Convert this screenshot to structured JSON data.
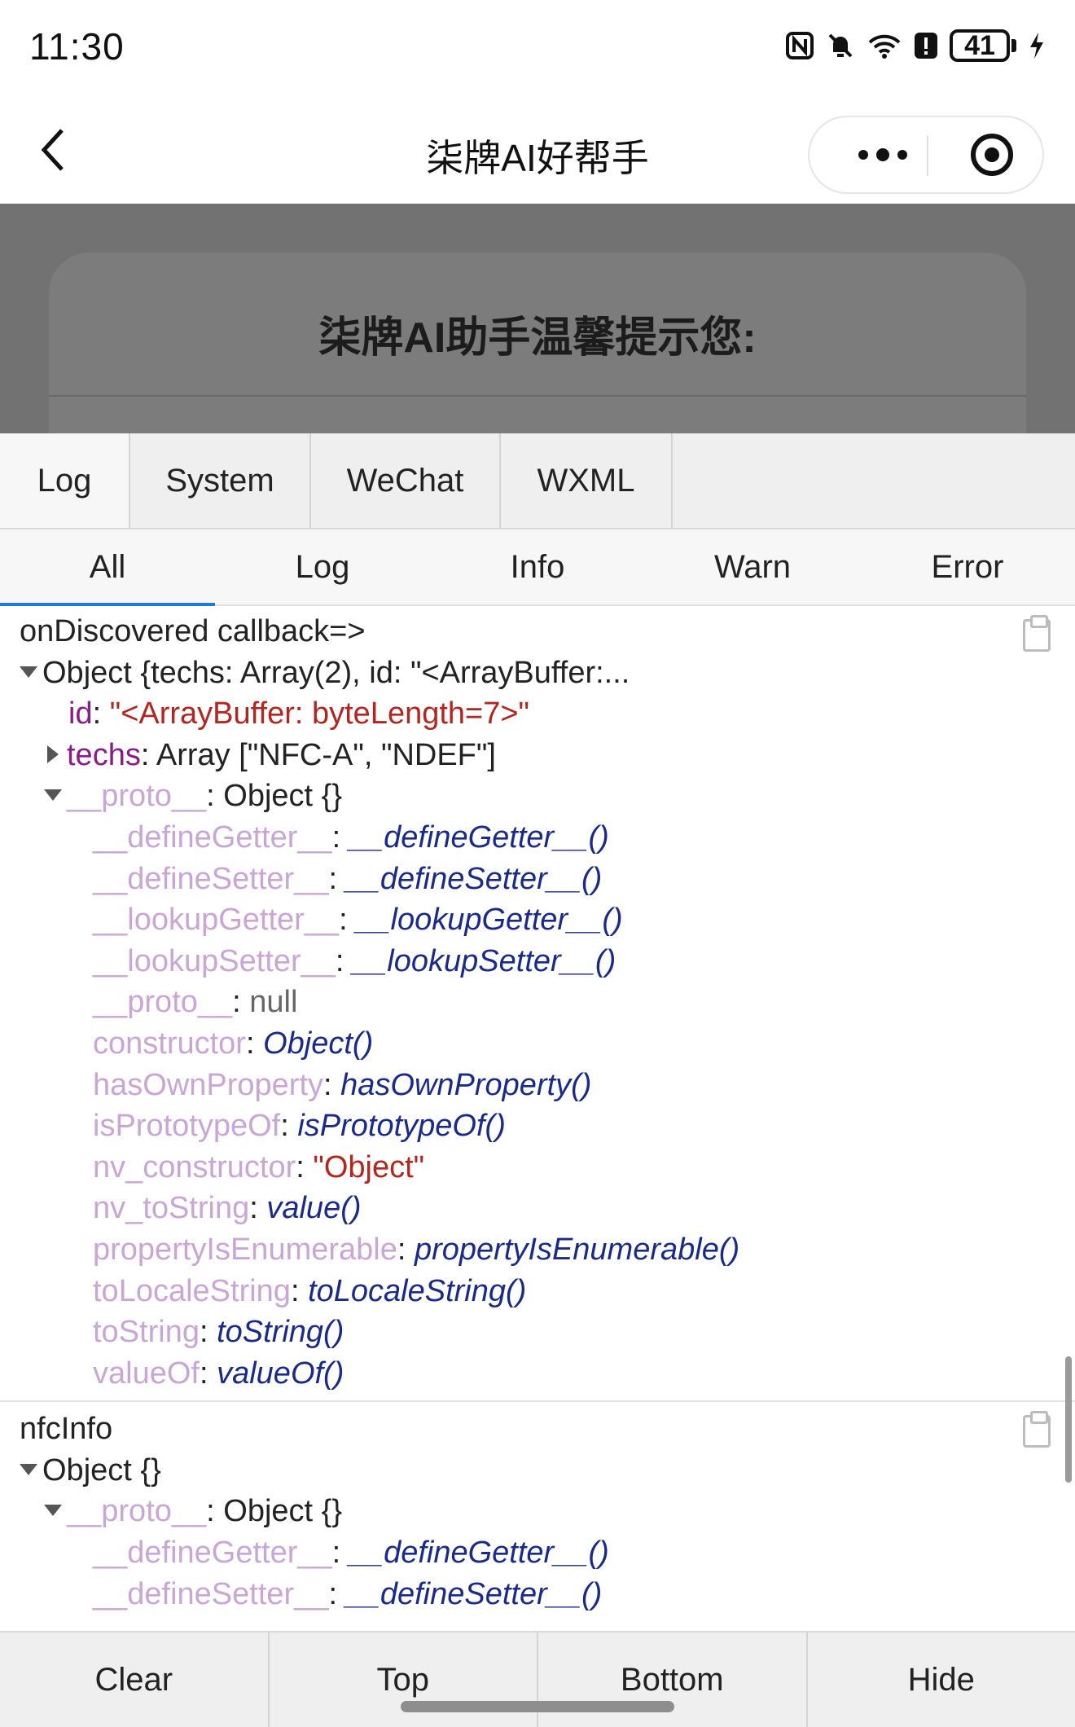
{
  "status_bar": {
    "time": "11:30",
    "battery": "41",
    "icons": [
      "nfc-icon",
      "bell-muted-icon",
      "wifi-icon",
      "alert-icon",
      "battery-icon",
      "charging-icon"
    ]
  },
  "title_bar": {
    "title": "柒牌AI好帮手",
    "icons": [
      "back-icon",
      "more-icon",
      "close-miniprogram-icon"
    ]
  },
  "background_modal": {
    "title": "柒牌AI助手温馨提示您:"
  },
  "console": {
    "tabs": [
      "Log",
      "System",
      "WeChat",
      "WXML"
    ],
    "filters": [
      "All",
      "Log",
      "Info",
      "Warn",
      "Error"
    ],
    "active_filter": "All",
    "entries": [
      {
        "title": "onDiscovered callback=>",
        "object_line": "Object {techs: Array(2), id: \"<ArrayBuffer:...",
        "id_key": "id",
        "id_value": "\"<ArrayBuffer: byteLength=7>\"",
        "techs_key": "techs",
        "techs_value": "Array [\"NFC-A\", \"NDEF\"]",
        "proto_key": "__proto__",
        "proto_value": "Object {}",
        "proto_members": [
          {
            "key": "__defineGetter__",
            "value": "__defineGetter__()",
            "kind": "fn"
          },
          {
            "key": "__defineSetter__",
            "value": "__defineSetter__()",
            "kind": "fn"
          },
          {
            "key": "__lookupGetter__",
            "value": "__lookupGetter__()",
            "kind": "fn"
          },
          {
            "key": "__lookupSetter__",
            "value": "__lookupSetter__()",
            "kind": "fn"
          },
          {
            "key": "__proto__",
            "value": "null",
            "kind": "null"
          },
          {
            "key": "constructor",
            "value": "Object()",
            "kind": "fn"
          },
          {
            "key": "hasOwnProperty",
            "value": "hasOwnProperty()",
            "kind": "fn"
          },
          {
            "key": "isPrototypeOf",
            "value": "isPrototypeOf()",
            "kind": "fn"
          },
          {
            "key": "nv_constructor",
            "value": "\"Object\"",
            "kind": "str"
          },
          {
            "key": "nv_toString",
            "value": "value()",
            "kind": "fn"
          },
          {
            "key": "propertyIsEnumerable",
            "value": "propertyIsEnumerable()",
            "kind": "fn"
          },
          {
            "key": "toLocaleString",
            "value": "toLocaleString()",
            "kind": "fn"
          },
          {
            "key": "toString",
            "value": "toString()",
            "kind": "fn"
          },
          {
            "key": "valueOf",
            "value": "valueOf()",
            "kind": "fn"
          }
        ]
      },
      {
        "title": "nfcInfo",
        "object_line": "Object {}",
        "proto_key": "__proto__",
        "proto_value": "Object {}",
        "proto_members": [
          {
            "key": "__defineGetter__",
            "value": "__defineGetter__()",
            "kind": "fn"
          },
          {
            "key": "__defineSetter__",
            "value": "__defineSetter__()",
            "kind": "fn"
          }
        ]
      }
    ],
    "bottom_buttons": [
      "Clear",
      "Top",
      "Bottom",
      "Hide"
    ]
  }
}
